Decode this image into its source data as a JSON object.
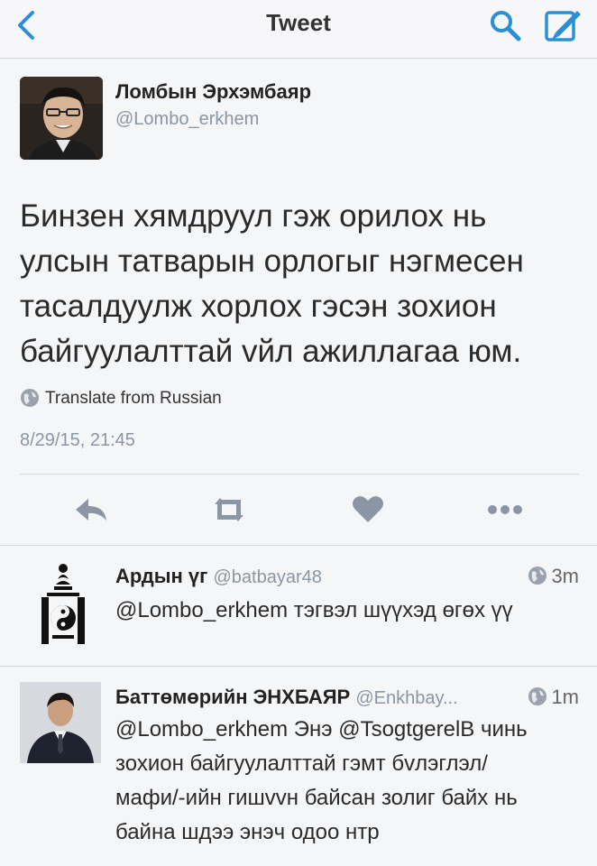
{
  "nav": {
    "title": "Tweet",
    "back_icon": "chevron-left-icon",
    "search_icon": "search-icon",
    "compose_icon": "compose-icon",
    "accent": "#2b8fd6"
  },
  "main_tweet": {
    "author_name": "Ломбын Эрхэмбаяр",
    "author_handle": "@Lombo_erkhem",
    "text_lines": [
      "Бинзен хямдруул гэж орилох нь",
      "улсын татварын орлогыг нэгмесен",
      "тасалдуулж хорлох гэсэн зохион",
      "байгуулалттай vйл ажиллагаа юм."
    ],
    "translate_label": "Translate from Russian",
    "timestamp": "8/29/15, 21:45",
    "actions": [
      "reply-icon",
      "retweet-icon",
      "like-icon",
      "more-icon"
    ]
  },
  "replies": [
    {
      "name": "Ардын үг",
      "handle": "@batbayar48",
      "time": "3m",
      "text_lines": [
        "@Lombo_erkhem тэгвэл шүүхэд өгөх үү"
      ]
    },
    {
      "name": "Баттөмөрийн ЭНХБАЯР",
      "handle": "@Enkhbay...",
      "time": "1m",
      "text_lines": [
        "@Lombo_erkhem Энэ @TsogtgerelB чинь",
        "зохион байгуулалттай гэмт бvлэглэл/",
        "мафи/-ийн гишvvн байсан золиг байх нь",
        "байна шдээ энэч одоо нтр"
      ]
    }
  ]
}
